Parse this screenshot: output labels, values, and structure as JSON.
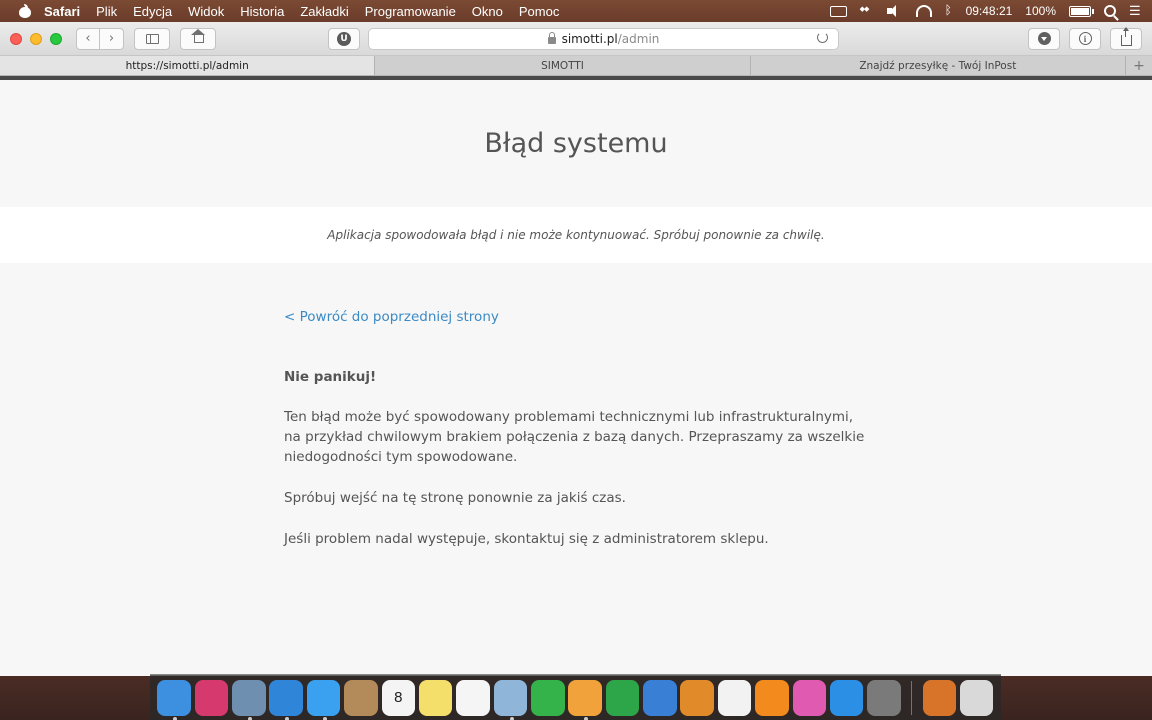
{
  "menubar": {
    "app": "Safari",
    "items": [
      "Plik",
      "Edycja",
      "Widok",
      "Historia",
      "Zakładki",
      "Programowanie",
      "Okno",
      "Pomoc"
    ],
    "time": "09:48:21",
    "battery": "100%"
  },
  "toolbar": {
    "extension_label": "U",
    "url_domain": "simotti.pl",
    "url_path": "/admin"
  },
  "tabs": [
    {
      "label": "https://simotti.pl/admin",
      "active": true
    },
    {
      "label": "SIMOTTI",
      "active": false
    },
    {
      "label": "Znajdź przesyłkę - Twój InPost",
      "active": false
    }
  ],
  "page": {
    "title": "Błąd systemu",
    "subtitle": "Aplikacja spowodowała błąd i nie może kontynuować. Spróbuj ponownie za chwilę.",
    "back_link": "< Powróć do poprzedniej strony",
    "heading": "Nie panikuj!",
    "paragraphs": [
      "Ten błąd może być spowodowany problemami technicznymi lub infrastrukturalnymi, na przykład chwilowym brakiem połączenia z bazą danych. Przepraszamy za wszelkie niedogodności tym spowodowane.",
      "Spróbuj wejść na tę stronę ponownie za jakiś czas.",
      "Jeśli problem nadal występuje, skontaktuj się z administratorem sklepu."
    ]
  },
  "dock": {
    "apps": [
      {
        "name": "finder-icon",
        "color": "#3d8fe0",
        "running": true
      },
      {
        "name": "launchpad-icon",
        "color": "#d6396d",
        "running": false
      },
      {
        "name": "photo-preview-icon",
        "color": "#6f8fb0",
        "running": true
      },
      {
        "name": "safari-icon",
        "color": "#2f86d8",
        "running": true
      },
      {
        "name": "messages-icon",
        "color": "#3aa0f0",
        "running": true
      },
      {
        "name": "contacts-icon",
        "color": "#b38a5a",
        "running": false
      },
      {
        "name": "calendar-icon",
        "color": "#f4f4f4",
        "running": false,
        "glyph": "8"
      },
      {
        "name": "notes-icon",
        "color": "#f3df6a",
        "running": false
      },
      {
        "name": "reminders-icon",
        "color": "#f5f5f5",
        "running": false
      },
      {
        "name": "preview-icon",
        "color": "#8fb6d8",
        "running": true
      },
      {
        "name": "facetime-icon",
        "color": "#33b34a",
        "running": false
      },
      {
        "name": "pages-icon",
        "color": "#f1a23b",
        "running": true
      },
      {
        "name": "numbers-icon",
        "color": "#2da64a",
        "running": false
      },
      {
        "name": "keynote-icon",
        "color": "#3a7fd6",
        "running": false
      },
      {
        "name": "iphoto-icon",
        "color": "#e18a2a",
        "running": false
      },
      {
        "name": "photos-icon",
        "color": "#f2f2f2",
        "running": false
      },
      {
        "name": "ibooks-icon",
        "color": "#f28a1e",
        "running": false
      },
      {
        "name": "itunes-icon",
        "color": "#e05ab2",
        "running": false
      },
      {
        "name": "app-store-icon",
        "color": "#2b8fe6",
        "running": false
      },
      {
        "name": "system-preferences-icon",
        "color": "#7a7a7a",
        "running": false
      }
    ],
    "right": [
      {
        "name": "downloads-stack-icon",
        "color": "#d7742a"
      },
      {
        "name": "trash-icon",
        "color": "#d9d9d9"
      }
    ]
  }
}
